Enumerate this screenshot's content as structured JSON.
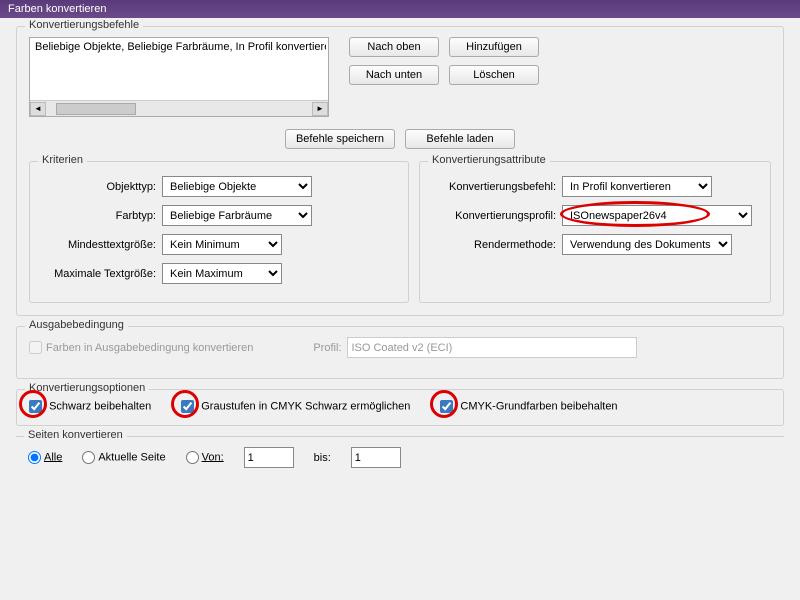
{
  "title": "Farben konvertieren",
  "commands_group": "Konvertierungsbefehle",
  "list_item": "Beliebige Objekte, Beliebige Farbräume, In Profil konvertieren",
  "btn_up": "Nach oben",
  "btn_add": "Hinzufügen",
  "btn_down": "Nach unten",
  "btn_delete": "Löschen",
  "btn_save": "Befehle speichern",
  "btn_load": "Befehle laden",
  "criteria_group": "Kriterien",
  "obj_type_lbl": "Objekttyp:",
  "obj_type": "Beliebige Objekte",
  "color_type_lbl": "Farbtyp:",
  "color_type": "Beliebige Farbräume",
  "min_text_lbl": "Mindesttextgröße:",
  "min_text": "Kein Minimum",
  "max_text_lbl": "Maximale Textgröße:",
  "max_text": "Kein Maximum",
  "attr_group": "Konvertierungsattribute",
  "conv_cmd_lbl": "Konvertierungsbefehl:",
  "conv_cmd": "In Profil konvertieren",
  "conv_profile_lbl": "Konvertierungsprofil:",
  "conv_profile": "ISOnewspaper26v4",
  "render_lbl": "Rendermethode:",
  "render": "Verwendung des Dokuments",
  "output_group": "Ausgabebedingung",
  "output_check": "Farben in Ausgabebedingung konvertieren",
  "profile_lbl": "Profil:",
  "profile_val": "ISO Coated v2 (ECI)",
  "options_group": "Konvertierungsoptionen",
  "opt_black": "Schwarz beibehalten",
  "opt_gray": "Graustufen in CMYK Schwarz ermöglichen",
  "opt_cmyk": "CMYK-Grundfarben beibehalten",
  "pages_group": "Seiten konvertieren",
  "pg_all": "Alle",
  "pg_current": "Aktuelle Seite",
  "pg_from": "Von:",
  "pg_to": "bis:",
  "pg_from_val": "1",
  "pg_to_val": "1"
}
